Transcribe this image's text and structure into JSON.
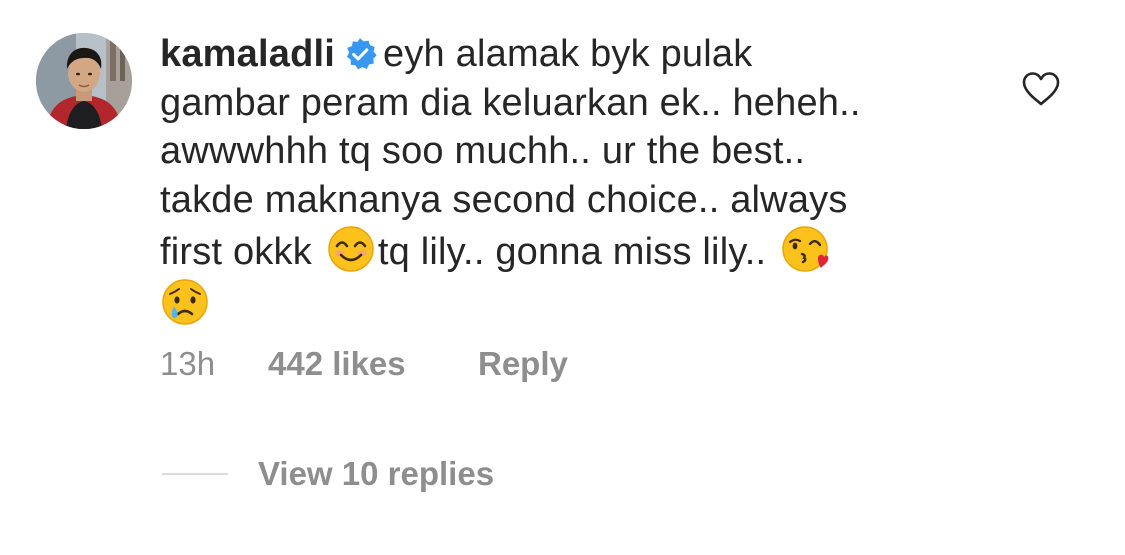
{
  "comment": {
    "username": "kamaladli",
    "verified_icon": "verified-badge-icon",
    "lines": [
      "eyh alamak byk pulak",
      "gambar peram dia keluarkan ek.. heheh..",
      "awwwhhh tq soo muchh.. ur the best..",
      "takde maknanya second choice.. always",
      "first okkk",
      "tq lily.. gonna miss lily.."
    ],
    "emojis": [
      "smiling-face-emoji",
      "face-blowing-kiss-emoji",
      "crying-face-emoji"
    ],
    "time": "13h",
    "likes": "442 likes",
    "reply_label": "Reply",
    "view_replies_label": "View 10 replies",
    "like_icon": "heart-outline-icon",
    "accent_color": "#3897f0",
    "muted_color": "#8e8e8e"
  }
}
